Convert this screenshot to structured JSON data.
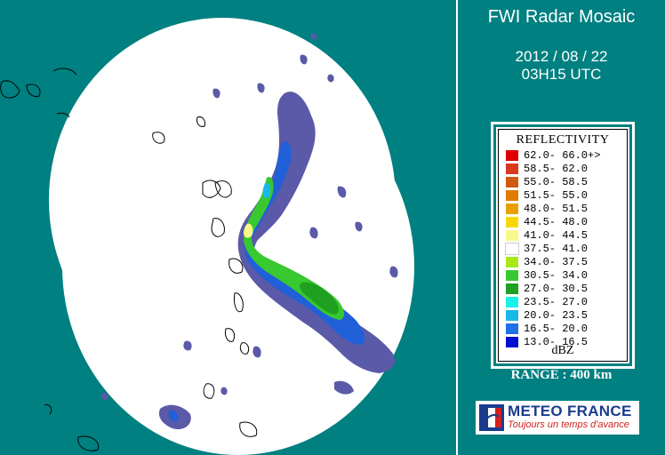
{
  "header": {
    "title": "FWI Radar Mosaic",
    "date": "2012 / 08 / 22",
    "time": "03H15 UTC"
  },
  "legend": {
    "title": "REFLECTIVITY",
    "unit": "dBZ",
    "items": [
      {
        "label": "62.0- 66.0+>",
        "color": "#e00000"
      },
      {
        "label": "58.5- 62.0",
        "color": "#d83a1c"
      },
      {
        "label": "55.0- 58.5",
        "color": "#d05a10"
      },
      {
        "label": "51.5- 55.0",
        "color": "#e07a00"
      },
      {
        "label": "48.0- 51.5",
        "color": "#e8a000"
      },
      {
        "label": "44.5- 48.0",
        "color": "#f8d800"
      },
      {
        "label": "41.0- 44.5",
        "color": "#f8f888"
      },
      {
        "label": "37.5- 41.0",
        "color": "#ffffff"
      },
      {
        "label": "34.0- 37.5",
        "color": "#a8e818"
      },
      {
        "label": "30.5- 34.0",
        "color": "#38c830"
      },
      {
        "label": "27.0- 30.5",
        "color": "#20a020"
      },
      {
        "label": "23.5- 27.0",
        "color": "#18f0e8"
      },
      {
        "label": "20.0- 23.5",
        "color": "#18b8e8"
      },
      {
        "label": "16.5- 20.0",
        "color": "#2070e8"
      },
      {
        "label": "13.0- 16.5",
        "color": "#0010d0"
      }
    ]
  },
  "range_label": "RANGE : 400 km",
  "logo": {
    "name": "METEO FRANCE",
    "slogan": "Toujours un temps d'avance"
  },
  "colors": {
    "background": "#008080",
    "coverage": "#ffffff",
    "echo_faint": "#5a5aa8",
    "echo_blue": "#2060d8"
  }
}
